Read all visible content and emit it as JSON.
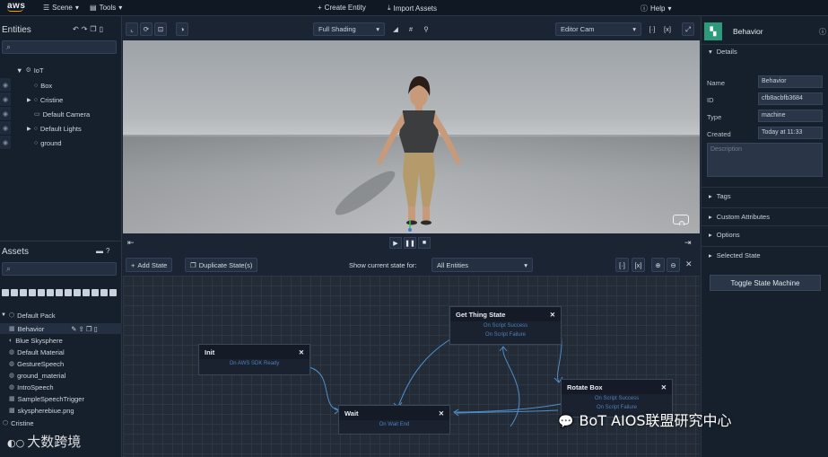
{
  "topbar": {
    "logo": "aws",
    "menus": [
      {
        "icon": "hamburger-icon",
        "label": "Scene"
      },
      {
        "icon": "tools-icon",
        "label": "Tools"
      }
    ],
    "actions": [
      {
        "icon": "plus-icon",
        "label": "Create Entity"
      },
      {
        "icon": "import-icon",
        "label": "Import Assets"
      }
    ],
    "help": "Help"
  },
  "entities": {
    "title": "Entities",
    "tree": [
      {
        "label": "IoT",
        "level": 0
      },
      {
        "label": "Box",
        "level": 1
      },
      {
        "label": "Cristine",
        "level": 1
      },
      {
        "label": "Default Camera",
        "level": 1
      },
      {
        "label": "Default Lights",
        "level": 1
      },
      {
        "label": "ground",
        "level": 1
      }
    ]
  },
  "assets": {
    "title": "Assets",
    "pack": "Default Pack",
    "items": [
      "Behavior",
      "Blue Skysphere",
      "Default Material",
      "GestureSpeech",
      "ground_material",
      "IntroSpeech",
      "SampleSpeechTrigger",
      "skyspherebiue.png"
    ],
    "second_pack": "Cristine"
  },
  "viewport": {
    "shading": "Full Shading",
    "camera": "Editor Cam"
  },
  "graph": {
    "add_state": "Add State",
    "duplicate_state": "Duplicate State(s)",
    "show_state_label": "Show current state for:",
    "show_state_value": "All Entities",
    "nodes": {
      "init": {
        "title": "Init",
        "transitions": [
          "On AWS SDK Ready"
        ]
      },
      "get_thing_state": {
        "title": "Get Thing State",
        "transitions": [
          "On Script Success",
          "On Script Failure"
        ]
      },
      "wait": {
        "title": "Wait",
        "transitions": [
          "On Wait End"
        ]
      },
      "rotate_box": {
        "title": "Rotate Box",
        "transitions": [
          "On Script Success",
          "On Script Failure"
        ]
      }
    }
  },
  "inspector": {
    "title": "Behavior",
    "details_label": "Details",
    "fields": [
      {
        "label": "Name",
        "value": "Behavior"
      },
      {
        "label": "ID",
        "value": "cfb8acbfb3684"
      },
      {
        "label": "Type",
        "value": "machine"
      },
      {
        "label": "Created",
        "value": "Today at 11:33"
      }
    ],
    "description_placeholder": "Description",
    "sections": [
      "Tags",
      "Custom Attributes",
      "Options",
      "Selected State"
    ],
    "toggle_button": "Toggle State Machine"
  },
  "watermarks": {
    "left": "大数跨境",
    "right": "BoT AIOS联盟研究中心"
  },
  "colors": {
    "accent_green": "#2e9a7c",
    "edge_blue": "#4f8fc9",
    "transition_text": "#4f7fb8"
  }
}
